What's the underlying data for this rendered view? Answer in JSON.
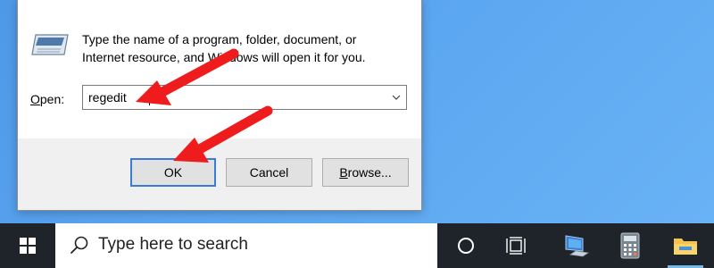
{
  "run_dialog": {
    "description_line1": "Type the name of a program, folder, document, or",
    "description_line2": "Internet resource, and Windows will open it for you.",
    "open_label_access": "O",
    "open_label_rest": "pen:",
    "open_value": "regedit",
    "ok_label": "OK",
    "cancel_label": "Cancel",
    "browse_label_access": "B",
    "browse_label_rest": "rowse..."
  },
  "taskbar": {
    "search_placeholder": "Type here to search",
    "start_icon": "windows-logo-icon",
    "search_icon": "magnifier-icon",
    "cortana_icon": "circle-icon",
    "taskview_icon": "task-view-icon",
    "pinned": [
      {
        "icon": "computer-icon"
      },
      {
        "icon": "calculator-icon"
      },
      {
        "icon": "folder-icon"
      }
    ]
  },
  "annotations": {
    "arrow_color": "#ee1c1c"
  },
  "colors": {
    "desktop": "#5aa5f0",
    "taskbar": "#1f232a",
    "focus_border": "#3a7bd5"
  }
}
